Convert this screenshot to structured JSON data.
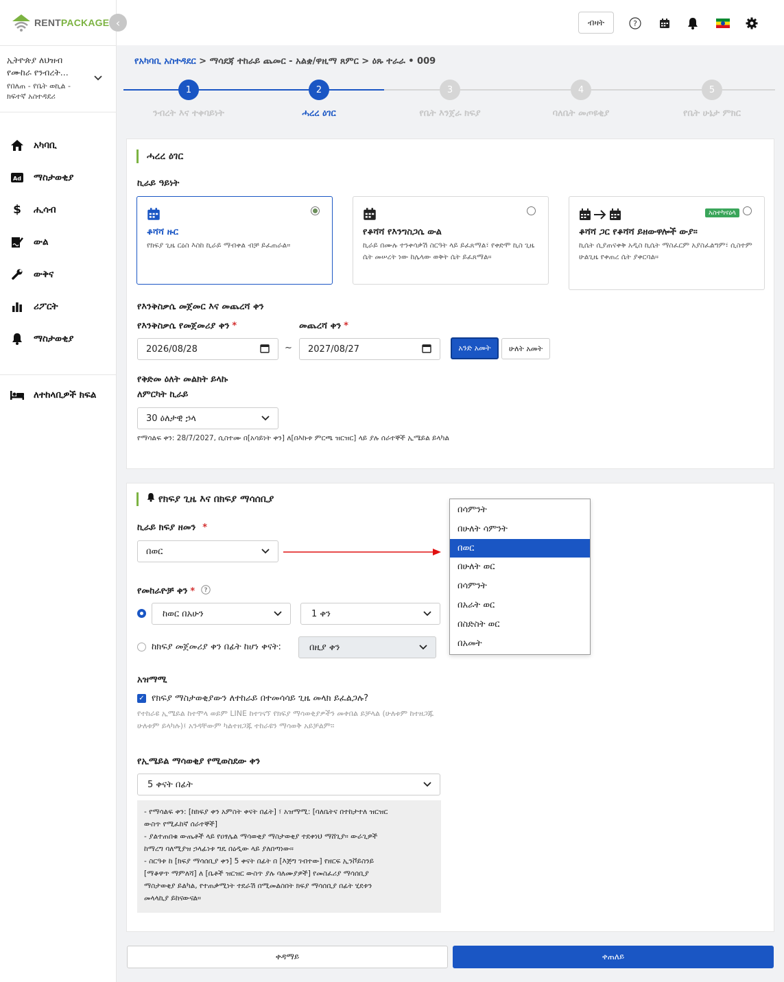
{
  "brand": {
    "rent": "RENT",
    "package": "PACKAGE"
  },
  "sidebar": {
    "org_line1": "ኢትዮጵያ ለህዝብ",
    "org_line2": "የሙከራ የንብረት...",
    "org_line3": "የበለጠ - የቤት ወኪል -",
    "org_line4": "ክፍተኛ አስተዳደሪ",
    "items": [
      {
        "label": "አካባቢ",
        "icon": "home-icon"
      },
      {
        "label": "ማስታወቂያ",
        "icon": "ad-icon"
      },
      {
        "label": "ሒሳብ",
        "icon": "dollar-icon"
      },
      {
        "label": "ውል",
        "icon": "contract-icon"
      },
      {
        "label": "ውቅና",
        "icon": "wrench-icon"
      },
      {
        "label": "ሪፖርት",
        "icon": "bar-chart-icon"
      },
      {
        "label": "ማስታወቂያ",
        "icon": "bell-icon"
      }
    ],
    "bottom_item": {
      "label": "ለተከላቢዎች ክፍል",
      "icon": "bed-icon"
    }
  },
  "topbar": {
    "login_label": "ብዛት",
    "flag": "ethiopia-flag-icon"
  },
  "breadcrumb": {
    "root": "የአካባቢ አስተዳደር",
    "rest": " > ማሳደጃ ተከራይ ጨመር - አልቋ/ዋዚማ ጸምር > ዕጹ ተራራ • 009"
  },
  "stepper": {
    "steps": [
      {
        "num": "1",
        "label": "ንብረት እና ተቀባይነት"
      },
      {
        "num": "2",
        "label": "ሓረረ ዕገር"
      },
      {
        "num": "3",
        "label": "የቤት እንጀራ ክፍያ"
      },
      {
        "num": "4",
        "label": "ባለቤት መጦዩቂያ"
      },
      {
        "num": "5",
        "label": "የቤት ሁኔታ ምክር"
      }
    ]
  },
  "section1": {
    "title": "ሓረረ ዕገር",
    "rent_type_label": "ኪራይ ዓይነት",
    "options": [
      {
        "title": "ቆሻሻ ዙር",
        "desc": "የክፍያ ጊዜ ርዕስ እስከ ኪራይ ማብቀል ብቻ ይፈጠራል።"
      },
      {
        "title": "የቆሻሻ የእንግስጋሴ ውል",
        "desc": "ኪራይ በሙሉ ተንቀሳቃሽ ስርዓት ላይ ይፈጸማል፣ የቀድሞ ኪስ ጊዜ ሴት መሠረት ነው ከሌላው ወቅት ሴት ይፈጸማል።"
      },
      {
        "title": "ቆሻሻ ጋር የቆሻሻ ይዘውዋሎች ውያ።",
        "desc": "ኪሴት ሲያጠናቀቅ አዲስ ኪሴት ማስፈርም አያስፈልግም፣ ሲስተም ሁልጊዜ የቀጠረ ሴት ያቀርባል።",
        "badge": "አስተካናዕላ"
      }
    ],
    "period_label": "የእንቅስቃሴ መጀመር እና መጨረሻ ቀን",
    "start_label": "የእንቅስቃሴ የመጀመሪያ ቀን",
    "end_label": "መጨረሻ ቀን",
    "start_value": "2026/08/28",
    "end_value": "2027/08/27",
    "tilde": "~",
    "one_year": "አንድ አመት",
    "two_year": "ሁለት አመት",
    "notice_label_1": "የቅድመ ዕለት መልክት ይላኩ",
    "notice_label_2": "ለምርካት ኪራይ",
    "notice_value": "30 ዕለታዊ ኃላ",
    "notice_note": "የማሳልፍ ቀን: 28/7/2027, ሲስተሙ በ[አሳይነት ቀን] ለ[በእኩቱ ምርጫ ዝርዝር] ላይ ያሉ ሰራተኞች ኢሜይል ይላካል"
  },
  "section2": {
    "title": "የክፍያ ጊዜ እና በክፍያ ማሳሰቢያ",
    "cycle_label": "ኪራይ ክፍያ ዘመን",
    "cycle_value": "በወር",
    "cycle_options": [
      "በሳምንት",
      "በሁለት ሳምንት",
      "በወር",
      "በሁለት ወር",
      "በሳምንት",
      "በአራት ወር",
      "በስድስት ወር",
      "በአመት"
    ],
    "due_label": "የመከራዮቻ ቀን",
    "due_opt1_sel1": "ከወር በአሁን",
    "due_opt1_sel2": "1 ቀን",
    "due_opt2_label": "ከክፍያ መጀመሪያ ቀን በፊት ከሆነ ቀናት:",
    "due_opt2_sel": "በዚያ ቀን",
    "reminder_label": "አዝማሚ",
    "reminder_check": "የክፍያ ማስታወቂያውን ለተከራይ በተመሳሳይ ጊዜ መላክ ይፈልጋሉ?",
    "reminder_help": "የተከራዩ ኢሜይል ከተሞላ ወይም LINE ከተገናኘ የክፍያ ማሳወቂያዎችን መቀበል ይቻላል (ሁለቱም ከተዘጋጁ ሁለቱም ይላካሉ)፤ አንዳቸውም ካልተዘጋጁ ተከራዩን ማሳወቅ አይቻልም።",
    "email_label": "የኢሜይል ማሳወቂያ የሚወስደው ቀን",
    "email_value": "5 ቀናት በፊት",
    "info_lines": [
      "- የማሳልፍ ቀን: [ከክፍያ ቀን አምስት ቀናት በፊት] ፣ አዝማሚ: [ባለቤትና በተከታተለ ዝርዝር",
      "ውስጥ የሚፈከኛ ሰራተኞች]",
      "- ያልተጠበቁ ውጤቶች ላይ የዐፃሌል ማሳወቂያ ማስታወቂያ ተደቀነህ ማሸጊያ። ውራጊዎች",
      "ከማረግ ባለሚያዝ ኃላፊነቱ ግዴ በዕዲው ላይ ያለበጣነው።",
      "- ስርዓቱ ከ [ክፍያ ማሳሰቢያ ቀን] 5 ቀናት በፊት በ [እጅግ ገብተው] የዘርፍ ኢንቮይስንይ",
      "[ማቆዋጥ ማምለሻ] ለ [ቤቶች ዝርዝር ውስጥ ያሉ ባለሙያዎች] የመስፈሪያ ማሳሰቢያ",
      "ማስታወቂያ ይልካል, የተጠቃሚነት ተደራሽ በሚመልስበት ክፍያ ማሳሰቢያ በፊት ሂደቱን",
      "መላላኪያ ይከናውናል።"
    ]
  },
  "footer": {
    "prev_label": "ቀዳማይ",
    "next_label": "ቀጠለይ"
  },
  "colors": {
    "primary": "#1a56c4",
    "accent_green": "#7cb342",
    "badge_green": "#3aa55a",
    "arrow_red": "#e01010"
  }
}
